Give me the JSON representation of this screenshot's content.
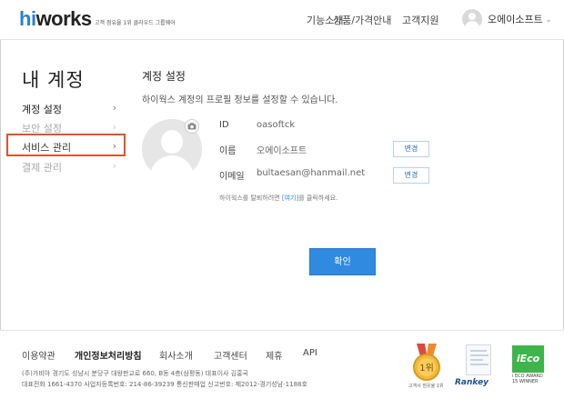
{
  "header": {
    "logo_hi": "hi",
    "logo_works": "works",
    "tagline": "고객 점유율 1위 클라우드 그룹웨어",
    "nav": [
      "기능소개",
      "상품/가격안내",
      "고객지원"
    ],
    "user_name": "오에이소프트"
  },
  "sidebar": {
    "title": "내 계정",
    "items": [
      {
        "label": "계정 설정",
        "arrow": "›"
      },
      {
        "label": "보안 설정",
        "arrow": "›"
      },
      {
        "label": "서비스 관리",
        "arrow": "›"
      },
      {
        "label": "결제 관리",
        "arrow": "›"
      }
    ]
  },
  "main": {
    "title": "계정 설정",
    "description": "하이웍스 계정의 프로필 정보를 설정할 수 있습니다.",
    "fields": [
      {
        "label": "ID",
        "value": "oasoftck"
      },
      {
        "label": "이름",
        "value": "오에이소프트",
        "button": "변경"
      },
      {
        "label": "이메일",
        "value": "bultaesan@hanmail.net",
        "button": "변경"
      }
    ],
    "withdraw_pre": "하이웍스를 탈퇴하려면 ",
    "withdraw_link": "[여기]",
    "withdraw_post": "를 클릭하세요.",
    "confirm": "확인"
  },
  "footer": {
    "links": [
      "이용약관",
      "개인정보처리방침",
      "회사소개",
      "고객센터",
      "제휴",
      "API"
    ],
    "info_line1": "(주)가비아     경기도 성남시 분당구 대왕판교로 660, B동 4층(삼평동)     대표이사 김홍국",
    "info_line2": "대표전화 1661-4370     사업자등록번호: 214-86-39239     통신판매업 신고번호: 제2012-경기성남-1188호",
    "medal_text": "1위",
    "medal_caption": "고객사 점유율 1위",
    "rankey": "Rankey",
    "ieco": "iEco",
    "ieco_caption1": "i ECO AWARD",
    "ieco_caption2": "15 WINNER"
  }
}
